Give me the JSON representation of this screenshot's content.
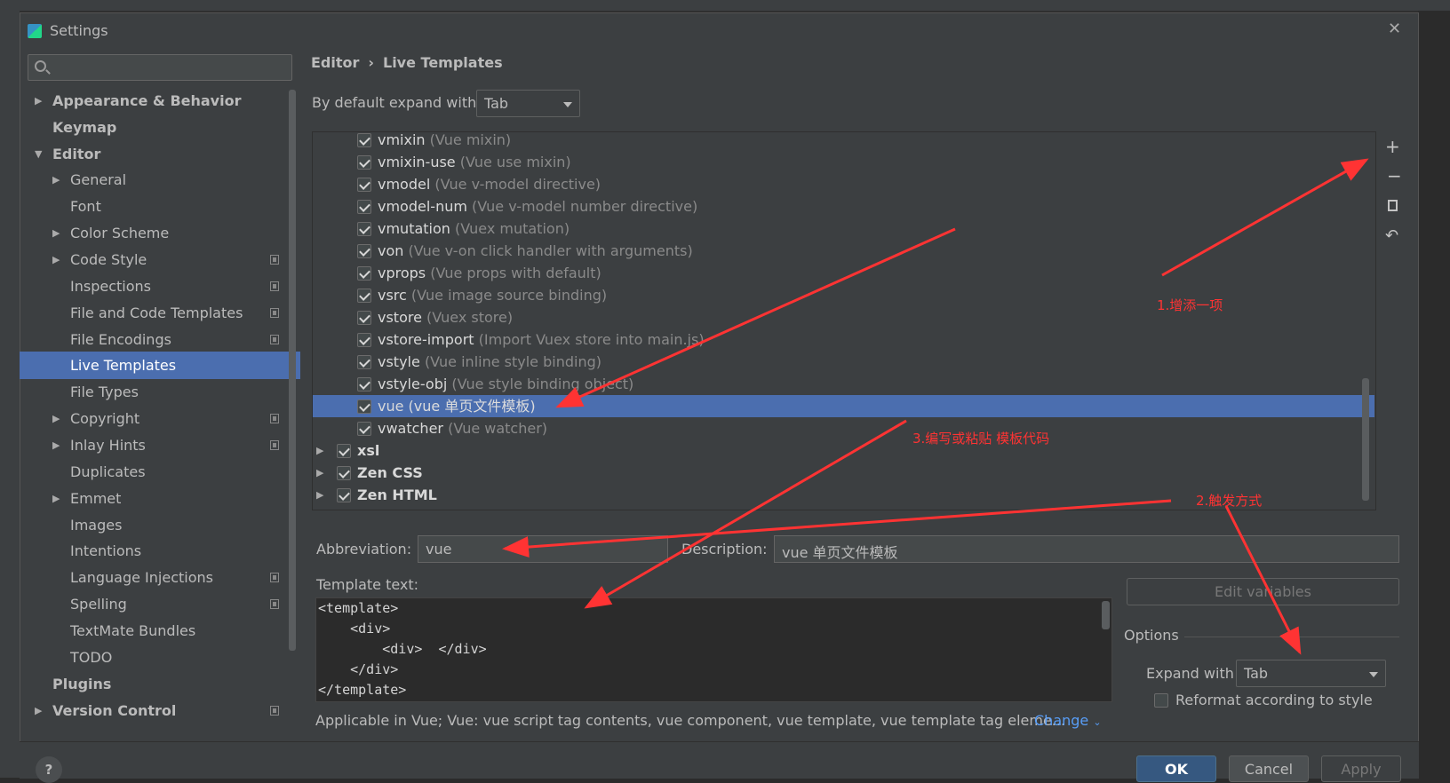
{
  "dialog": {
    "title": "Settings"
  },
  "search": {
    "placeholder": ""
  },
  "sidebar": {
    "items": [
      {
        "label": "Appearance & Behavior"
      },
      {
        "label": "Keymap"
      },
      {
        "label": "Editor"
      },
      {
        "label": "General"
      },
      {
        "label": "Font"
      },
      {
        "label": "Color Scheme"
      },
      {
        "label": "Code Style"
      },
      {
        "label": "Inspections"
      },
      {
        "label": "File and Code Templates"
      },
      {
        "label": "File Encodings"
      },
      {
        "label": "Live Templates"
      },
      {
        "label": "File Types"
      },
      {
        "label": "Copyright"
      },
      {
        "label": "Inlay Hints"
      },
      {
        "label": "Duplicates"
      },
      {
        "label": "Emmet"
      },
      {
        "label": "Images"
      },
      {
        "label": "Intentions"
      },
      {
        "label": "Language Injections"
      },
      {
        "label": "Spelling"
      },
      {
        "label": "TextMate Bundles"
      },
      {
        "label": "TODO"
      },
      {
        "label": "Plugins"
      },
      {
        "label": "Version Control"
      }
    ]
  },
  "breadcrumb": {
    "parent": "Editor",
    "separator": "›",
    "current": "Live Templates"
  },
  "default_expand": {
    "label": "By default expand with",
    "value": "Tab"
  },
  "templates": [
    {
      "name": "vmixin",
      "desc": "(Vue mixin)"
    },
    {
      "name": "vmixin-use",
      "desc": "(Vue use mixin)"
    },
    {
      "name": "vmodel",
      "desc": "(Vue v-model directive)"
    },
    {
      "name": "vmodel-num",
      "desc": "(Vue v-model number directive)"
    },
    {
      "name": "vmutation",
      "desc": "(Vuex mutation)"
    },
    {
      "name": "von",
      "desc": "(Vue v-on click handler with arguments)"
    },
    {
      "name": "vprops",
      "desc": "(Vue props with default)"
    },
    {
      "name": "vsrc",
      "desc": "(Vue image source binding)"
    },
    {
      "name": "vstore",
      "desc": "(Vuex store)"
    },
    {
      "name": "vstore-import",
      "desc": "(Import Vuex store into main.js)"
    },
    {
      "name": "vstyle",
      "desc": "(Vue inline style binding)"
    },
    {
      "name": "vstyle-obj",
      "desc": "(Vue style binding object)"
    },
    {
      "name": "vue",
      "desc": "(vue 单页文件模板)"
    },
    {
      "name": "vwatcher",
      "desc": "(Vue watcher)"
    }
  ],
  "groups": [
    {
      "name": "xsl"
    },
    {
      "name": "Zen CSS"
    },
    {
      "name": "Zen HTML"
    }
  ],
  "form": {
    "abbreviation_label": "Abbreviation:",
    "abbreviation_value": "vue",
    "description_label": "Description:",
    "description_value": "vue 单页文件模板",
    "template_text_label": "Template text:",
    "template_lines": [
      "<template>",
      "    <div>",
      "        <div>  </div>",
      "    </div>",
      "</template>"
    ],
    "edit_variables": "Edit variables",
    "options_label": "Options",
    "expand_with_label": "Expand with",
    "expand_with_value": "Tab",
    "reformat_label": "Reformat according to style",
    "applicable": "Applicable in Vue; Vue: vue script tag contents, vue component, vue template, vue template tag eleme...",
    "change": "Change"
  },
  "buttons": {
    "ok": "OK",
    "cancel": "Cancel",
    "apply": "Apply",
    "help": "?"
  },
  "annotations": {
    "a1": "1.增添一项",
    "a2": "2.触发方式",
    "a3": "3.编写或粘贴 模板代码"
  },
  "colors": {
    "selection": "#4b6eaf",
    "annotation": "#ff3333",
    "link": "#589df6"
  }
}
